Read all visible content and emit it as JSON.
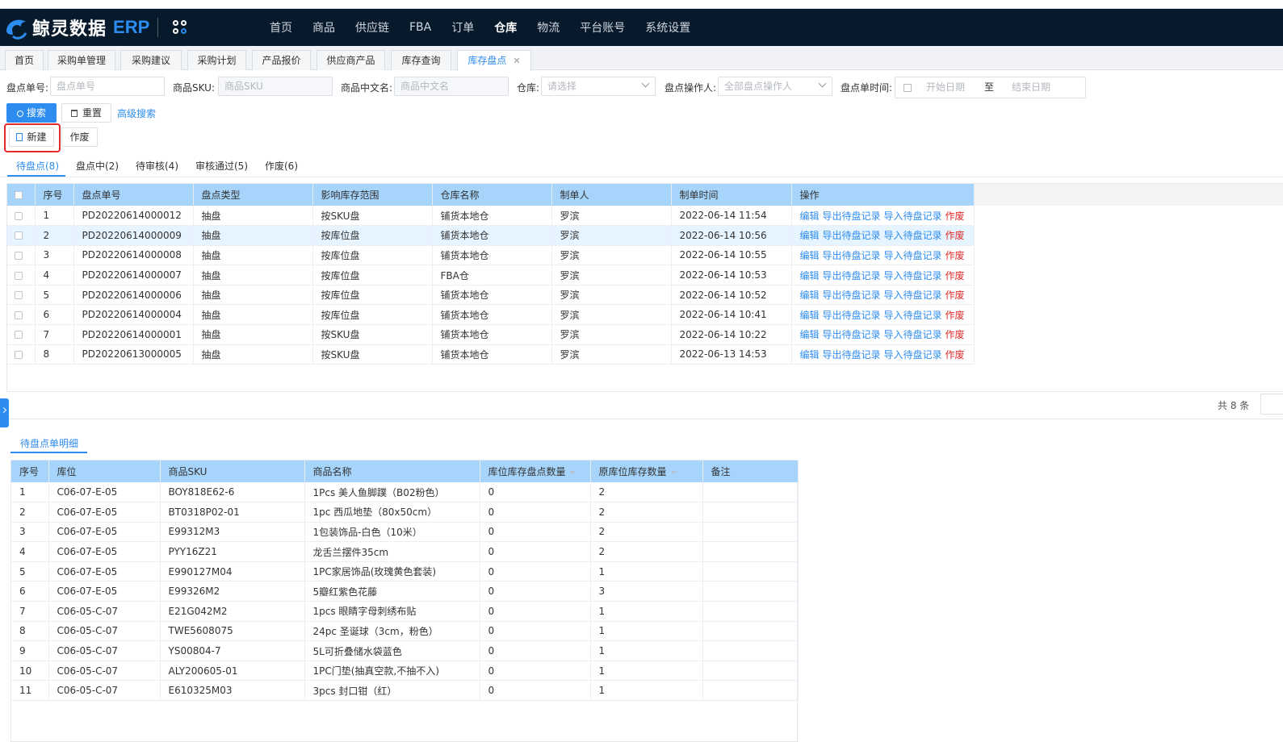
{
  "header": {
    "logo_text": "鲸灵数据",
    "logo_suffix": "ERP",
    "nav": [
      "首页",
      "商品",
      "供应链",
      "FBA",
      "订单",
      "仓库",
      "物流",
      "平台账号",
      "系统设置"
    ],
    "nav_active": "仓库"
  },
  "page_tabs": [
    "首页",
    "采购单管理",
    "采购建议",
    "采购计划",
    "产品报价",
    "供应商产品",
    "库存查询",
    "库存盘点"
  ],
  "filters": {
    "order_no_label": "盘点单号:",
    "order_no_placeholder": "盘点单号",
    "sku_label": "商品SKU:",
    "sku_placeholder": "商品SKU",
    "cn_name_label": "商品中文名:",
    "cn_name_placeholder": "商品中文名",
    "warehouse_label": "仓库:",
    "warehouse_placeholder": "请选择",
    "operator_label": "盘点操作人:",
    "operator_placeholder": "全部盘点操作人",
    "time_label": "盘点单时间:",
    "start_placeholder": "开始日期",
    "to_text": "至",
    "end_placeholder": "结束日期"
  },
  "actions": {
    "search": "搜索",
    "reset": "重置",
    "advanced": "高级搜索",
    "new": "新建",
    "void": "作废"
  },
  "status_tabs": [
    "待盘点(8)",
    "盘点中(2)",
    "待审核(4)",
    "审核通过(5)",
    "作废(6)"
  ],
  "main_table": {
    "columns": [
      "序号",
      "盘点单号",
      "盘点类型",
      "影响库存范围",
      "仓库名称",
      "制单人",
      "制单时间",
      "操作"
    ],
    "rows": [
      [
        "1",
        "PD20220614000012",
        "抽盘",
        "按SKU盘",
        "铺货本地仓",
        "罗滨",
        "2022-06-14 11:54"
      ],
      [
        "2",
        "PD20220614000009",
        "抽盘",
        "按库位盘",
        "铺货本地仓",
        "罗滨",
        "2022-06-14 10:56"
      ],
      [
        "3",
        "PD20220614000008",
        "抽盘",
        "按库位盘",
        "铺货本地仓",
        "罗滨",
        "2022-06-14 10:55"
      ],
      [
        "4",
        "PD20220614000007",
        "抽盘",
        "按库位盘",
        "FBA仓",
        "罗滨",
        "2022-06-14 10:53"
      ],
      [
        "5",
        "PD20220614000006",
        "抽盘",
        "按库位盘",
        "铺货本地仓",
        "罗滨",
        "2022-06-14 10:52"
      ],
      [
        "6",
        "PD20220614000004",
        "抽盘",
        "按库位盘",
        "铺货本地仓",
        "罗滨",
        "2022-06-14 10:41"
      ],
      [
        "7",
        "PD20220614000001",
        "抽盘",
        "按SKU盘",
        "铺货本地仓",
        "罗滨",
        "2022-06-14 10:22"
      ],
      [
        "8",
        "PD20220613000005",
        "抽盘",
        "按SKU盘",
        "铺货本地仓",
        "罗滨",
        "2022-06-13 14:53"
      ]
    ],
    "row_actions": [
      "编辑",
      "导出待盘记录",
      "导入待盘记录",
      "作废"
    ],
    "total": "共 8 条"
  },
  "detail": {
    "tab": "待盘点单明细",
    "columns": [
      "序号",
      "库位",
      "商品SKU",
      "商品名称",
      "库位库存盘点数量",
      "原库位库存数量",
      "备注"
    ],
    "rows": [
      [
        "1",
        "C06-07-E-05",
        "BOY818E62-6",
        "1Pcs 美人鱼脚蹼（B02粉色）",
        "0",
        "2",
        ""
      ],
      [
        "2",
        "C06-07-E-05",
        "BT0318P02-01",
        "1pc 西瓜地垫（80x50cm）",
        "0",
        "2",
        ""
      ],
      [
        "3",
        "C06-07-E-05",
        "E99312M3",
        "1包装饰品-白色（10米）",
        "0",
        "2",
        ""
      ],
      [
        "4",
        "C06-07-E-05",
        "PYY16Z21",
        "龙舌兰摆件35cm",
        "0",
        "2",
        ""
      ],
      [
        "5",
        "C06-07-E-05",
        "E990127M04",
        "1PC家居饰品(玫瑰黄色套装)",
        "0",
        "1",
        ""
      ],
      [
        "6",
        "C06-07-E-05",
        "E99326M2",
        "5瓣红紫色花藤",
        "0",
        "3",
        ""
      ],
      [
        "7",
        "C06-05-C-07",
        "E21G042M2",
        "1pcs 眼睛字母刺绣布贴",
        "0",
        "1",
        ""
      ],
      [
        "8",
        "C06-05-C-07",
        "TWE5608075",
        "24pc 圣诞球（3cm，粉色）",
        "0",
        "1",
        ""
      ],
      [
        "9",
        "C06-05-C-07",
        "YS00804-7",
        "5L可折叠储水袋蓝色",
        "0",
        "1",
        ""
      ],
      [
        "10",
        "C06-05-C-07",
        "ALY200605-01",
        "1PC门垫(抽真空款,不抽不入)",
        "0",
        "1",
        ""
      ],
      [
        "11",
        "C06-05-C-07",
        "E610325M03",
        "3pcs 封口钳（红）",
        "0",
        "1",
        ""
      ]
    ]
  }
}
